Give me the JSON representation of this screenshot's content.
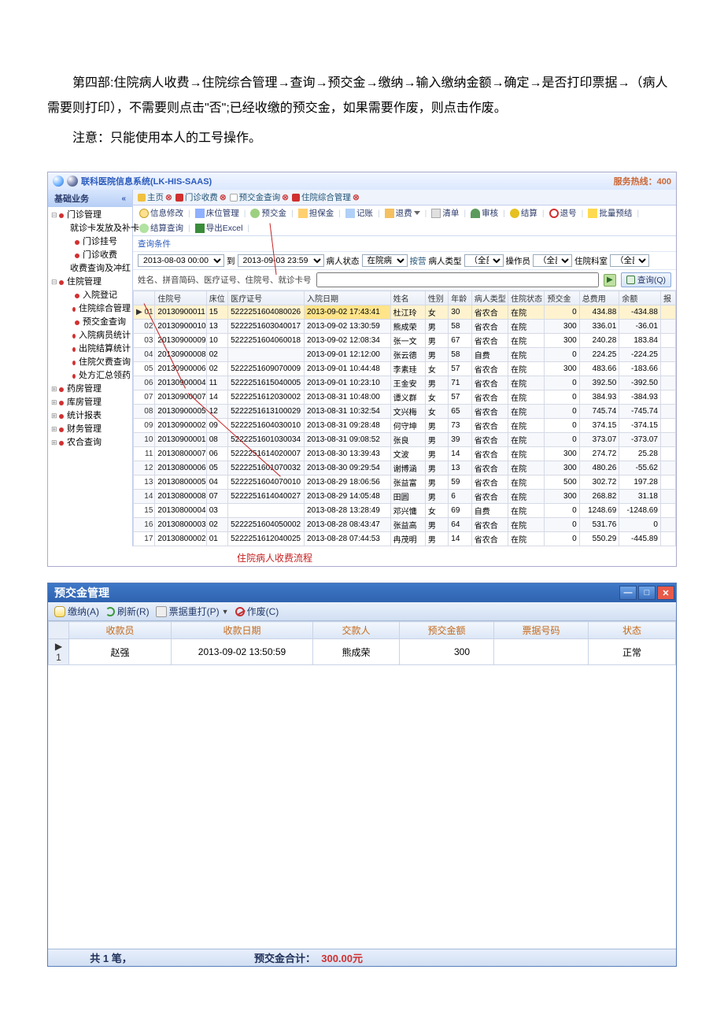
{
  "doc": {
    "p1": "第四部:住院病人收费→住院综合管理→查询→预交金→缴纳→输入缴纳金额→确定→是否打印票据→（病人需要则打印），不需要则点击\"否\";已经收缴的预交金，如果需要作废，则点击作废。",
    "p2": "注意：只能使用本人的工号操作。"
  },
  "his": {
    "title": "联科医院信息系统(LK-HIS-SAAS)",
    "hotline": "服务热线：400",
    "side_header": "基础业务",
    "tree": [
      {
        "lvl": 1,
        "label": "门诊管理",
        "collapser": "⊟"
      },
      {
        "lvl": 2,
        "label": "就诊卡发放及补卡"
      },
      {
        "lvl": 2,
        "label": "门诊挂号"
      },
      {
        "lvl": 2,
        "label": "门诊收费"
      },
      {
        "lvl": 2,
        "label": "收费查询及冲红"
      },
      {
        "lvl": 1,
        "label": "住院管理",
        "collapser": "⊟"
      },
      {
        "lvl": 2,
        "label": "入院登记"
      },
      {
        "lvl": 2,
        "label": "住院综合管理"
      },
      {
        "lvl": 2,
        "label": "预交金查询"
      },
      {
        "lvl": 2,
        "label": "入院病员统计"
      },
      {
        "lvl": 2,
        "label": "出院结算统计"
      },
      {
        "lvl": 2,
        "label": "住院欠费查询"
      },
      {
        "lvl": 2,
        "label": "处方汇总领药"
      },
      {
        "lvl": 1,
        "label": "药房管理",
        "collapser": "⊞"
      },
      {
        "lvl": 1,
        "label": "库房管理",
        "collapser": "⊞"
      },
      {
        "lvl": 1,
        "label": "统计报表",
        "collapser": "⊞"
      },
      {
        "lvl": 1,
        "label": "财务管理",
        "collapser": "⊞"
      },
      {
        "lvl": 1,
        "label": "农合查询",
        "collapser": "⊞"
      }
    ],
    "tabs": [
      {
        "label": "主页",
        "icon": "home"
      },
      {
        "label": "门诊收费",
        "icon": "red"
      },
      {
        "label": "预交金查询",
        "icon": "page"
      },
      {
        "label": "住院综合管理",
        "icon": "red"
      }
    ],
    "toolbar": [
      {
        "label": "信息修改",
        "icon": "info"
      },
      {
        "label": "床位管理",
        "icon": "bed"
      },
      {
        "label": "预交金",
        "icon": "money"
      },
      {
        "label": "担保金",
        "icon": "guar"
      },
      {
        "label": "记账",
        "icon": "note"
      },
      {
        "label": "退费",
        "icon": "back",
        "dd": true
      },
      {
        "label": "清单",
        "icon": "list"
      },
      {
        "label": "审核",
        "icon": "user"
      },
      {
        "label": "结算",
        "icon": "yel"
      },
      {
        "label": "退号",
        "icon": "no"
      },
      {
        "label": "批量预结",
        "icon": "star"
      },
      {
        "label": "结算查询",
        "icon": "batch"
      },
      {
        "label": "导出Excel",
        "icon": "x"
      }
    ],
    "query_label": "查询条件",
    "filters": {
      "date_from": "2013-08-03 00:00",
      "to_label": "到",
      "date_to": "2013-09-03 23:59",
      "status_label": "病人状态",
      "status_value": "在院病人",
      "type_label": "病人类型",
      "type_value": "（全部）",
      "op_label": "操作员",
      "op_value": "（全部）",
      "dept_label": "住院科室",
      "dept_value": "（全部）",
      "query_btn": "查询(Q)",
      "extra": "按营"
    },
    "hint": "姓名、拼音简码、医疗证号、住院号、就诊卡号",
    "grid_headers": [
      "",
      "住院号",
      "床位",
      "医疗证号",
      "入院日期",
      "姓名",
      "性别",
      "年龄",
      "病人类型",
      "住院状态",
      "预交金",
      "总费用",
      "余额",
      "报"
    ],
    "rows": [
      {
        "mark": "▶ 01",
        "zyh": "20130900011",
        "bed": "15",
        "cert": "5222251604080026",
        "date": "2013-09-02 17:43:41",
        "name": "杜江玲",
        "sex": "女",
        "age": "30",
        "type": "省农合",
        "sts": "在院",
        "pre": "0",
        "total": "434.88",
        "bal": "-434.88"
      },
      {
        "mark": "02",
        "zyh": "20130900010",
        "bed": "13",
        "cert": "5222251603040017",
        "date": "2013-09-02 13:30:59",
        "name": "熊成荣",
        "sex": "男",
        "age": "58",
        "type": "省农合",
        "sts": "在院",
        "pre": "300",
        "total": "336.01",
        "bal": "-36.01"
      },
      {
        "mark": "03",
        "zyh": "20130900009",
        "bed": "10",
        "cert": "5222251604060018",
        "date": "2013-09-02 12:08:34",
        "name": "张一文",
        "sex": "男",
        "age": "67",
        "type": "省农合",
        "sts": "在院",
        "pre": "300",
        "total": "240.28",
        "bal": "183.84"
      },
      {
        "mark": "04",
        "zyh": "20130900008",
        "bed": "02",
        "cert": "",
        "date": "2013-09-01 12:12:00",
        "name": "张云德",
        "sex": "男",
        "age": "58",
        "type": "自费",
        "sts": "在院",
        "pre": "0",
        "total": "224.25",
        "bal": "-224.25"
      },
      {
        "mark": "05",
        "zyh": "20130900006",
        "bed": "02",
        "cert": "5222251609070009",
        "date": "2013-09-01 10:44:48",
        "name": "李素珪",
        "sex": "女",
        "age": "57",
        "type": "省农合",
        "sts": "在院",
        "pre": "300",
        "total": "483.66",
        "bal": "-183.66"
      },
      {
        "mark": "06",
        "zyh": "20130900004",
        "bed": "11",
        "cert": "5222251615040005",
        "date": "2013-09-01 10:23:10",
        "name": "王金安",
        "sex": "男",
        "age": "71",
        "type": "省农合",
        "sts": "在院",
        "pre": "0",
        "total": "392.50",
        "bal": "-392.50"
      },
      {
        "mark": "07",
        "zyh": "20130900007",
        "bed": "14",
        "cert": "5222251612030002",
        "date": "2013-08-31 10:48:00",
        "name": "谭义群",
        "sex": "女",
        "age": "57",
        "type": "省农合",
        "sts": "在院",
        "pre": "0",
        "total": "384.93",
        "bal": "-384.93"
      },
      {
        "mark": "08",
        "zyh": "20130900005",
        "bed": "12",
        "cert": "5222251613100029",
        "date": "2013-08-31 10:32:54",
        "name": "文兴梅",
        "sex": "女",
        "age": "65",
        "type": "省农合",
        "sts": "在院",
        "pre": "0",
        "total": "745.74",
        "bal": "-745.74"
      },
      {
        "mark": "09",
        "zyh": "20130900002",
        "bed": "09",
        "cert": "5222251604030010",
        "date": "2013-08-31 09:28:48",
        "name": "何守坤",
        "sex": "男",
        "age": "73",
        "type": "省农合",
        "sts": "在院",
        "pre": "0",
        "total": "374.15",
        "bal": "-374.15"
      },
      {
        "mark": "10",
        "zyh": "20130900001",
        "bed": "08",
        "cert": "5222251601030034",
        "date": "2013-08-31 09:08:52",
        "name": "张良",
        "sex": "男",
        "age": "39",
        "type": "省农合",
        "sts": "在院",
        "pre": "0",
        "total": "373.07",
        "bal": "-373.07"
      },
      {
        "mark": "11",
        "zyh": "20130800007",
        "bed": "06",
        "cert": "5222251614020007",
        "date": "2013-08-30 13:39:43",
        "name": "文波",
        "sex": "男",
        "age": "14",
        "type": "省农合",
        "sts": "在院",
        "pre": "300",
        "total": "274.72",
        "bal": "25.28"
      },
      {
        "mark": "12",
        "zyh": "20130800006",
        "bed": "05",
        "cert": "5222251601070032",
        "date": "2013-08-30 09:29:54",
        "name": "谢博涵",
        "sex": "男",
        "age": "13",
        "type": "省农合",
        "sts": "在院",
        "pre": "300",
        "total": "480.26",
        "bal": "-55.62"
      },
      {
        "mark": "13",
        "zyh": "20130800005",
        "bed": "04",
        "cert": "5222251604070010",
        "date": "2013-08-29 18:06:56",
        "name": "张益富",
        "sex": "男",
        "age": "59",
        "type": "省农合",
        "sts": "在院",
        "pre": "500",
        "total": "302.72",
        "bal": "197.28"
      },
      {
        "mark": "14",
        "zyh": "20130800008",
        "bed": "07",
        "cert": "5222251614040027",
        "date": "2013-08-29 14:05:48",
        "name": "田圆",
        "sex": "男",
        "age": "6",
        "type": "省农合",
        "sts": "在院",
        "pre": "300",
        "total": "268.82",
        "bal": "31.18"
      },
      {
        "mark": "15",
        "zyh": "20130800004",
        "bed": "03",
        "cert": "",
        "date": "2013-08-28 13:28:49",
        "name": "邓兴慵",
        "sex": "女",
        "age": "69",
        "type": "自费",
        "sts": "在院",
        "pre": "0",
        "total": "1248.69",
        "bal": "-1248.69"
      },
      {
        "mark": "16",
        "zyh": "20130800003",
        "bed": "02",
        "cert": "5222251604050002",
        "date": "2013-08-28 08:43:47",
        "name": "张益高",
        "sex": "男",
        "age": "64",
        "type": "省农合",
        "sts": "在院",
        "pre": "0",
        "total": "531.76",
        "bal": "0"
      },
      {
        "mark": "17",
        "zyh": "20130800002",
        "bed": "01",
        "cert": "5222251612040025",
        "date": "2013-08-28 07:44:53",
        "name": "冉茂明",
        "sex": "男",
        "age": "14",
        "type": "省农合",
        "sts": "在院",
        "pre": "0",
        "total": "550.29",
        "bal": "-445.89"
      }
    ],
    "annotation": "住院病人收费流程"
  },
  "pre": {
    "title": "预交金管理",
    "toolbar": [
      {
        "label": "缴纳(A)",
        "icon": "pay"
      },
      {
        "label": "刷新(R)",
        "icon": "refresh"
      },
      {
        "label": "票据重打(P)",
        "icon": "print",
        "dd": true
      },
      {
        "label": "作废(C)",
        "icon": "void"
      }
    ],
    "headers": [
      "",
      "收款员",
      "收款日期",
      "交款人",
      "预交金额",
      "票据号码",
      "状态"
    ],
    "row": {
      "idx": "1",
      "cashier": "赵强",
      "date": "2013-09-02 13:50:59",
      "payer": "熊成荣",
      "amount": "300",
      "ticket": "",
      "status": "正常"
    },
    "footer_count": "共 1 笔，",
    "footer_label": "预交金合计：",
    "footer_amount": "300.00元"
  }
}
